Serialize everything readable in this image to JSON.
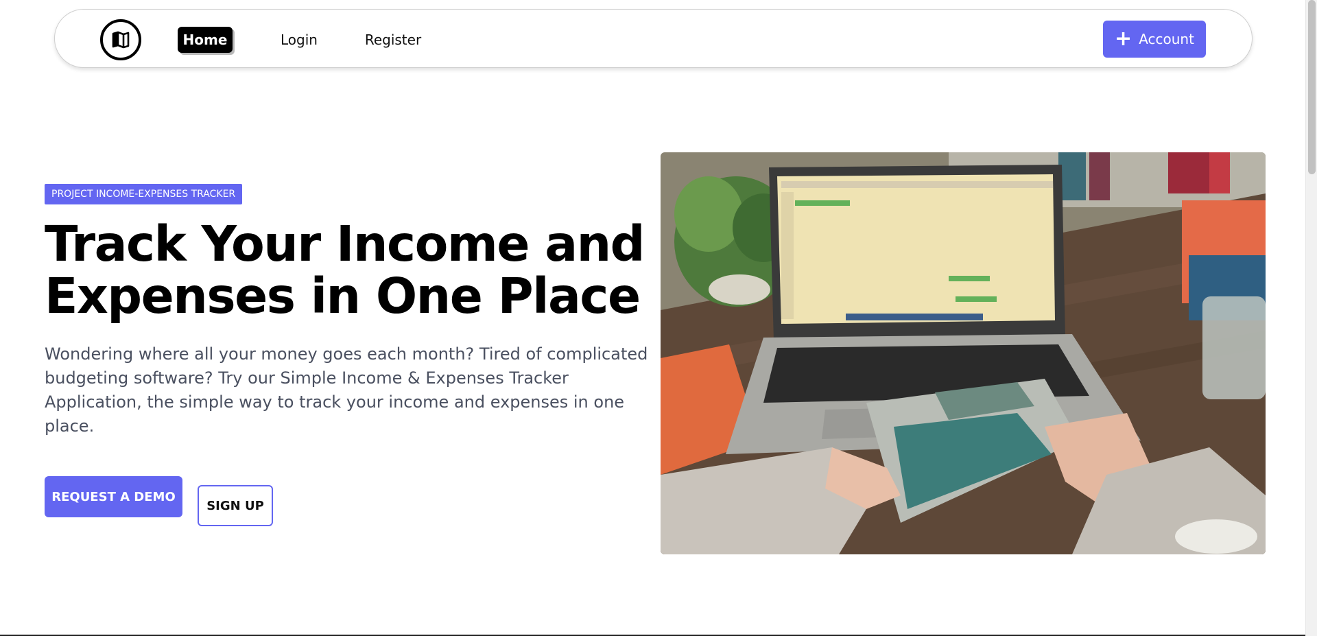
{
  "nav": {
    "home": "Home",
    "login": "Login",
    "register": "Register",
    "account": "Account",
    "logo_icon": "map-logo-icon",
    "plus_icon": "+"
  },
  "hero": {
    "badge": "PROJECT INCOME-EXPENSES TRACKER",
    "headline_line1": "Track Your Income and",
    "headline_line2": "Expenses in One Place",
    "description": "Wondering where all your money goes each month? Tired of complicated budgeting software? Try our Simple Income & Expenses Tracker Application, the simple way to track your income and expenses in one place.",
    "primary_button": "REQUEST A DEMO",
    "secondary_button": "SIGN UP"
  },
  "colors": {
    "accent": "#6366f1",
    "dark": "#000000",
    "text_muted": "#4a5060"
  }
}
